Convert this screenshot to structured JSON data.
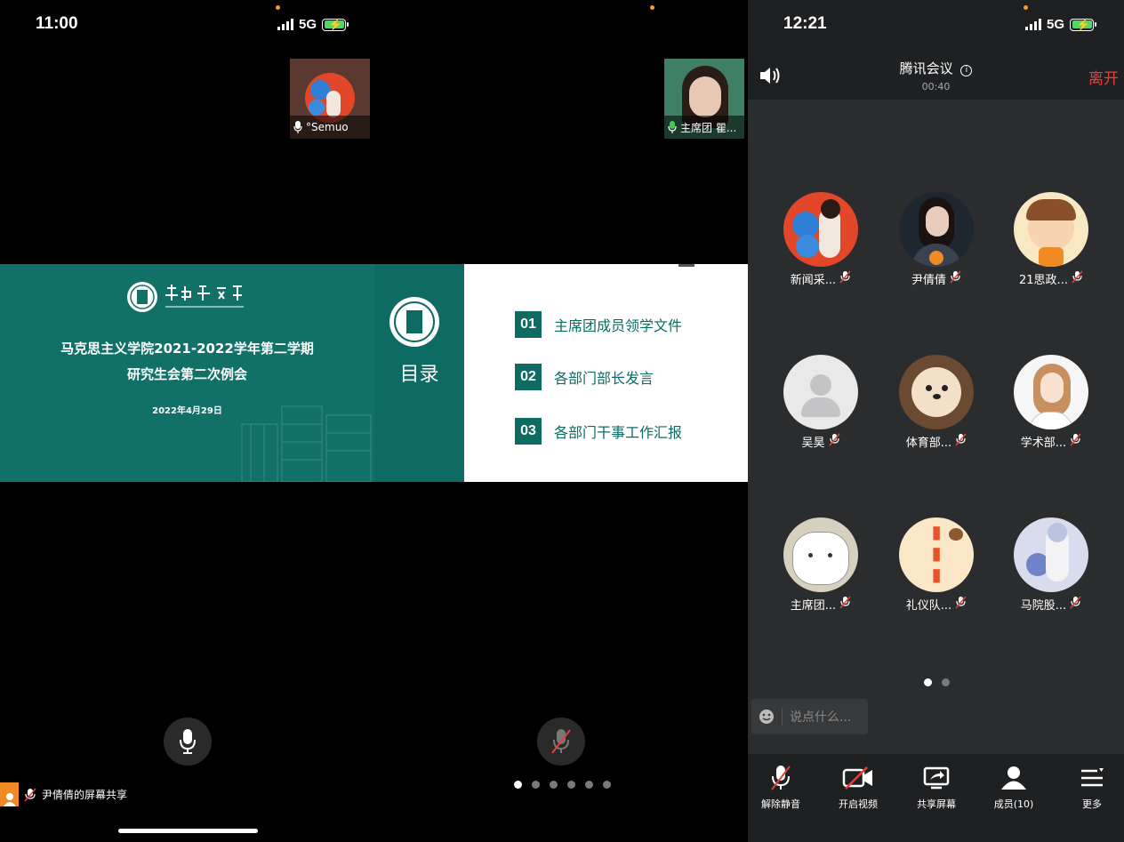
{
  "panel1": {
    "time": "11:00",
    "network": "5G",
    "tile_name": "°Semuo",
    "slide": {
      "title_line1": "马克思主义学院2021-2022学年第二学期",
      "title_line2": "研究生会第二次例会",
      "date": "2022年4月29日"
    },
    "share_label": "尹倩倩的屏幕共享"
  },
  "panel2": {
    "tile_name": "主席团 瞿...",
    "toc_heading": "目录",
    "toc": [
      {
        "num": "01",
        "text": "主席团成员领学文件"
      },
      {
        "num": "02",
        "text": "各部门部长发言"
      },
      {
        "num": "03",
        "text": "各部门干事工作汇报"
      }
    ],
    "page_dots": 6,
    "active_dot": 0
  },
  "panel3": {
    "time": "12:21",
    "network": "5G",
    "meeting_title": "腾讯会议",
    "duration": "00:40",
    "leave_label": "离开",
    "members": [
      {
        "name": "新闻采...",
        "avatar": "floral-girl"
      },
      {
        "name": "尹倩倩",
        "avatar": "portrait-dark"
      },
      {
        "name": "21思政...",
        "avatar": "cartoon-boy"
      },
      {
        "name": "吴昊",
        "avatar": "default-user"
      },
      {
        "name": "体育部...",
        "avatar": "puppy"
      },
      {
        "name": "学术部...",
        "avatar": "anime-girl"
      },
      {
        "name": "主席团...",
        "avatar": "white-cat"
      },
      {
        "name": "礼仪队...",
        "avatar": "orange-text"
      },
      {
        "name": "马院股...",
        "avatar": "blue-flower-girl"
      }
    ],
    "chat_placeholder": "说点什么...",
    "toolbar": {
      "unmute": "解除静音",
      "video": "开启视频",
      "share": "共享屏幕",
      "members": "成员(10)",
      "more": "更多"
    },
    "page_dots": 2,
    "active_dot": 0
  },
  "colors": {
    "slide_green": "#117068",
    "leave_red": "#e5413a",
    "panel_bg": "#2b2c2e"
  }
}
